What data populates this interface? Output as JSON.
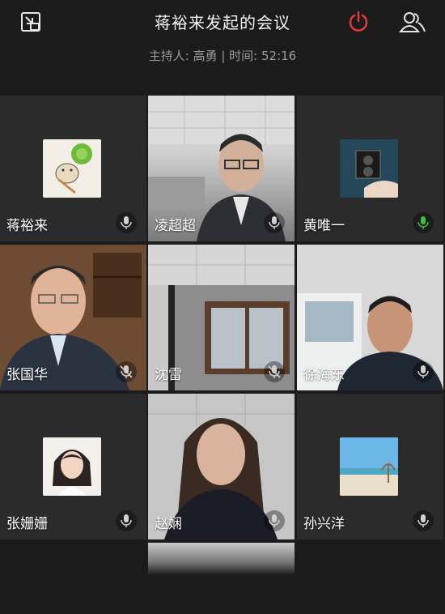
{
  "header": {
    "title": "蒋裕来发起的会议",
    "subtitle": "主持人: 高勇 | 时间: 52:16",
    "minimize_icon": "shrink-window-icon",
    "leave_icon": "power-icon",
    "members_icon": "members-icon",
    "leave_color": "#e03b3b"
  },
  "participants": [
    {
      "name": "蒋裕来",
      "mic": "muted",
      "type": "avatar"
    },
    {
      "name": "凌超超",
      "mic": "muted",
      "type": "video"
    },
    {
      "name": "黄唯一",
      "mic": "active",
      "type": "avatar"
    },
    {
      "name": "张国华",
      "mic": "muted-crossed",
      "type": "video"
    },
    {
      "name": "沈雷",
      "mic": "muted-crossed",
      "type": "video"
    },
    {
      "name": "徐海东",
      "mic": "muted",
      "type": "video"
    },
    {
      "name": "张姗姗",
      "mic": "muted",
      "type": "avatar"
    },
    {
      "name": "赵娴",
      "mic": "muted",
      "type": "video"
    },
    {
      "name": "孙兴洋",
      "mic": "muted",
      "type": "avatar"
    }
  ],
  "colors": {
    "mic_active": "#3fbf3f",
    "mic_default": "#d0d0d0"
  }
}
